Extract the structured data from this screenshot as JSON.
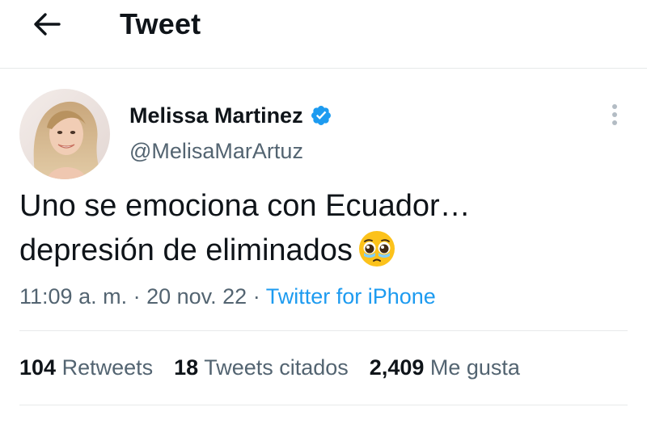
{
  "header": {
    "title": "Tweet"
  },
  "author": {
    "display_name": "Melissa Martinez",
    "handle": "@MelisaMarArtuz",
    "verified": true
  },
  "tweet": {
    "line1": "Uno se emociona con Ecuador…",
    "line2": "depresión de eliminados",
    "emoji": "pleading-face-with-tears"
  },
  "meta": {
    "time": "11:09 a. m.",
    "sep1": " · ",
    "date": "20 nov. 22",
    "sep2": " · ",
    "source": "Twitter for iPhone"
  },
  "stats": {
    "retweets_count": "104",
    "retweets_label": "Retweets",
    "quotes_count": "18",
    "quotes_label": "Tweets citados",
    "likes_count": "2,409",
    "likes_label": "Me gusta"
  },
  "colors": {
    "accent": "#1d9bf0",
    "secondary_text": "#536471",
    "primary_text": "#0f1419",
    "divider": "#e7e9ea"
  }
}
